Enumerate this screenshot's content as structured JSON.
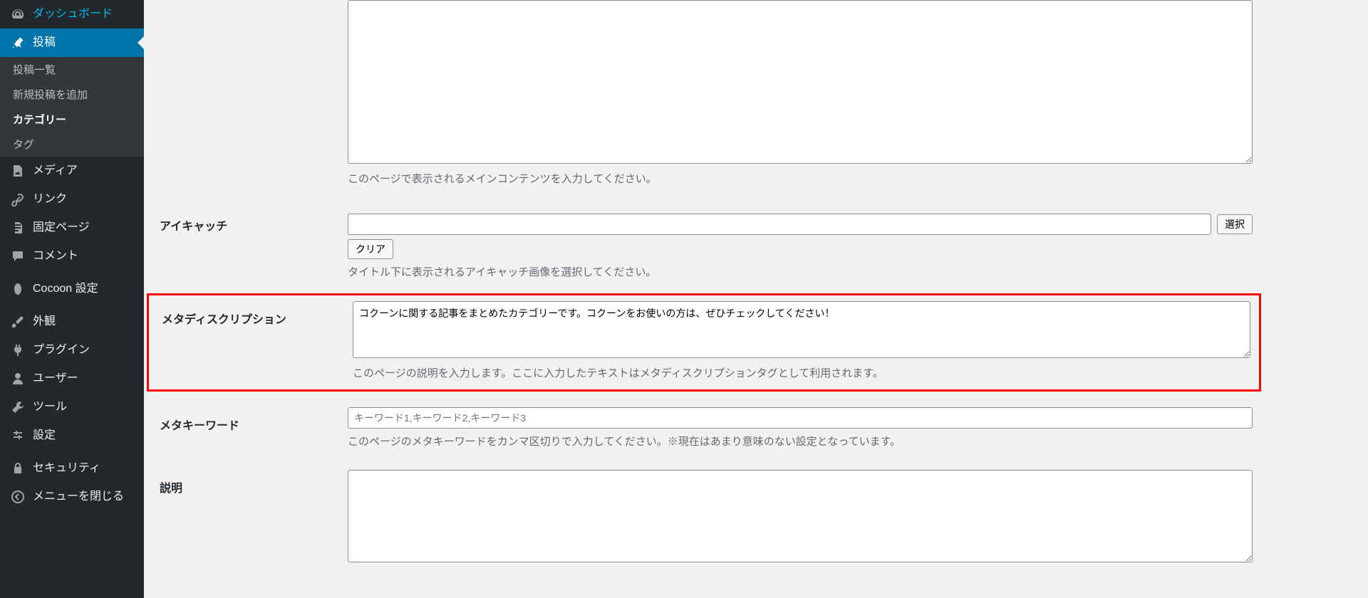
{
  "sidebar": {
    "items": [
      {
        "icon": "dashboard",
        "label": "ダッシュボード",
        "current": false
      },
      {
        "icon": "pin",
        "label": "投稿",
        "current": true
      },
      {
        "icon": "media",
        "label": "メディア",
        "current": false
      },
      {
        "icon": "link",
        "label": "リンク",
        "current": false
      },
      {
        "icon": "page",
        "label": "固定ページ",
        "current": false
      },
      {
        "icon": "comment",
        "label": "コメント",
        "current": false
      },
      {
        "icon": "cocoon",
        "label": "Cocoon 設定",
        "current": false
      },
      {
        "icon": "appearance",
        "label": "外観",
        "current": false
      },
      {
        "icon": "plugin",
        "label": "プラグイン",
        "current": false
      },
      {
        "icon": "user",
        "label": "ユーザー",
        "current": false
      },
      {
        "icon": "tool",
        "label": "ツール",
        "current": false
      },
      {
        "icon": "settings",
        "label": "設定",
        "current": false
      },
      {
        "icon": "security",
        "label": "セキュリティ",
        "current": false
      },
      {
        "icon": "collapse",
        "label": "メニューを閉じる",
        "current": false
      }
    ],
    "sub_items": [
      {
        "label": "投稿一覧",
        "active": false
      },
      {
        "label": "新規投稿を追加",
        "active": false
      },
      {
        "label": "カテゴリー",
        "active": true
      },
      {
        "label": "タグ",
        "active": false
      }
    ]
  },
  "form": {
    "main_content": {
      "value": "",
      "helper": "このページで表示されるメインコンテンツを入力してください。"
    },
    "eyecatch": {
      "label": "アイキャッチ",
      "value": "",
      "select_btn": "選択",
      "clear_btn": "クリア",
      "helper": "タイトル下に表示されるアイキャッチ画像を選択してください。"
    },
    "meta_description": {
      "label": "メタディスクリプション",
      "value": "コクーンに関する記事をまとめたカテゴリーです。コクーンをお使いの方は、ぜひチェックしてください！",
      "helper": "このページの説明を入力します。ここに入力したテキストはメタディスクリプションタグとして利用されます。"
    },
    "meta_keywords": {
      "label": "メタキーワード",
      "placeholder": "キーワード1,キーワード2,キーワード3",
      "value": "",
      "helper": "このページのメタキーワードをカンマ区切りで入力してください。※現在はあまり意味のない設定となっています。"
    },
    "description": {
      "label": "説明",
      "value": ""
    }
  }
}
